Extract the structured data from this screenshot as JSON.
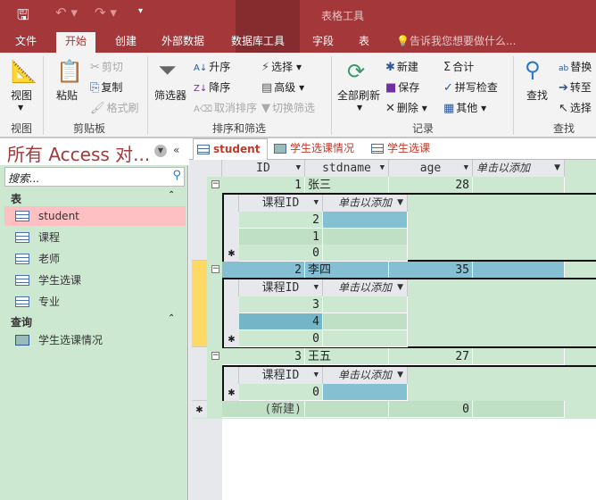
{
  "qat": {
    "save": "save-icon",
    "undo": "undo-icon",
    "redo": "redo-icon",
    "customize": "▾"
  },
  "context_title": "表格工具",
  "ribbon_tabs": [
    "文件",
    "开始",
    "创建",
    "外部数据",
    "数据库工具",
    "字段",
    "表"
  ],
  "tell_me": "告诉我您想要做什么...",
  "ribbon": {
    "view": "视图",
    "view_group": "视图",
    "paste": "粘贴",
    "cut": "剪切",
    "copy": "复制",
    "format_painter": "格式刷",
    "clipboard_group": "剪贴板",
    "filter": "筛选器",
    "asc": "升序",
    "desc": "降序",
    "clear_sort": "取消排序",
    "selection": "选择",
    "advanced": "高级",
    "toggle_filter": "切换筛选",
    "sort_group": "排序和筛选",
    "refresh_all": "全部刷新",
    "new": "新建",
    "save": "保存",
    "delete": "删除",
    "totals": "合计",
    "spelling": "拼写检查",
    "more": "其他",
    "records_group": "记录",
    "find": "查找",
    "replace": "替换",
    "goto": "转至",
    "select": "选择",
    "find_group": "查找"
  },
  "nav": {
    "title": "所有 Access 对...",
    "search_placeholder": "搜索...",
    "sections": [
      {
        "label": "表",
        "items": [
          "student",
          "课程",
          "老师",
          "学生选课",
          "专业"
        ]
      },
      {
        "label": "查询",
        "items": [
          "学生选课情况"
        ]
      }
    ]
  },
  "doc_tabs": [
    "student",
    "学生选课情况",
    "学生选课"
  ],
  "table": {
    "columns": [
      "ID",
      "stdname",
      "age",
      "单击以添加"
    ],
    "rows": [
      {
        "id": "1",
        "name": "张三",
        "age": "28",
        "sub": [
          "2",
          "1",
          "0"
        ]
      },
      {
        "id": "2",
        "name": "李四",
        "age": "35",
        "sub": [
          "3",
          "4",
          "0"
        ]
      },
      {
        "id": "3",
        "name": "王五",
        "age": "27",
        "sub": [
          "0"
        ]
      }
    ],
    "sub_columns": [
      "课程ID",
      "单击以添加"
    ],
    "new_row": {
      "id": "(新建)",
      "age": "0"
    }
  },
  "colors": {
    "accent": "#a4373a",
    "grid": "#cde8d0",
    "selected": "#85bfd2",
    "current_row": "#ffd966"
  }
}
